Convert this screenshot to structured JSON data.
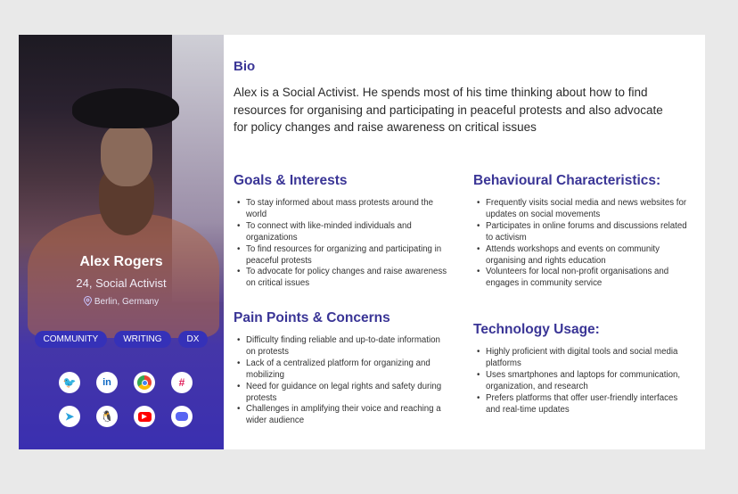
{
  "profile": {
    "name": "Alex Rogers",
    "role": "24, Social Activist",
    "location": "Berlin, Germany",
    "tags": [
      "COMMUNITY",
      "WRITING",
      "DX"
    ],
    "icons_row1": [
      "twitter-icon",
      "linkedin-icon",
      "chrome-icon",
      "slack-icon"
    ],
    "icons_row2": [
      "telegram-icon",
      "linux-icon",
      "youtube-icon",
      "discord-icon"
    ]
  },
  "bio": {
    "heading": "Bio",
    "text": "Alex is a Social Activist. He spends most of his time thinking about how to find resources for organising and participating in peaceful protests and also advocate for policy changes and raise awareness on critical issues"
  },
  "goals": {
    "heading": "Goals & Interests",
    "items": [
      "To stay informed about mass protests around the world",
      "To connect with like-minded individuals and organizations",
      "To find resources for organizing and participating in peaceful protests",
      "To advocate for policy changes and raise awareness on critical issues"
    ]
  },
  "pain": {
    "heading": "Pain Points & Concerns",
    "items": [
      "Difficulty finding reliable and up-to-date information on protests",
      "Lack of a centralized platform for organizing and mobilizing",
      "Need for guidance on legal rights and safety during protests",
      "Challenges in amplifying their voice and reaching a wider audience"
    ]
  },
  "behaviour": {
    "heading": "Behavioural Characteristics:",
    "items": [
      "Frequently visits social media and news websites for updates on social movements",
      "Participates in online forums and discussions related to activism",
      "Attends workshops and events on community organising and rights education",
      "Volunteers for local non-profit organisations and engages in community service"
    ]
  },
  "tech": {
    "heading": "Technology Usage:",
    "items": [
      "Highly proficient with digital tools and social media platforms",
      "Uses smartphones and laptops for communication, organization, and research",
      "Prefers platforms that offer user-friendly interfaces and real-time updates"
    ]
  },
  "colors": {
    "accent": "#3a3596",
    "tag": "#3531b8"
  }
}
